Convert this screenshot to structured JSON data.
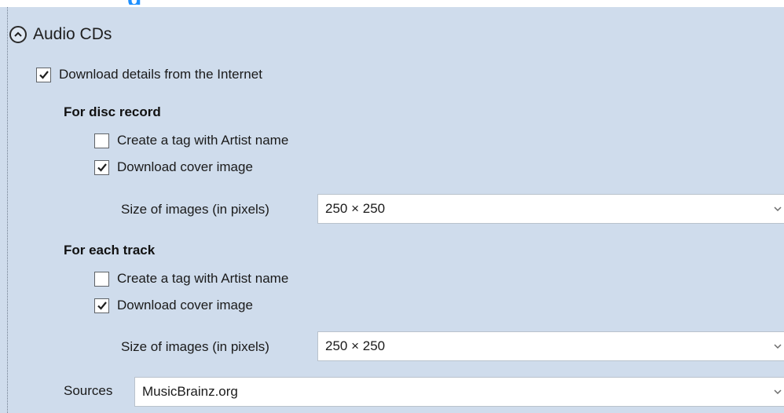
{
  "section": {
    "title": "Audio CDs"
  },
  "download_details": {
    "label": "Download details from the Internet",
    "checked": true
  },
  "disc_record": {
    "heading": "For disc record",
    "artist_tag": {
      "label": "Create a tag with Artist name",
      "checked": false
    },
    "cover_image": {
      "label": "Download cover image",
      "checked": true
    },
    "size_label": "Size of images (in pixels)",
    "size_value": "250 × 250"
  },
  "each_track": {
    "heading": "For each track",
    "artist_tag": {
      "label": "Create a tag with Artist name",
      "checked": false
    },
    "cover_image": {
      "label": "Download cover image",
      "checked": true
    },
    "size_label": "Size of images (in pixels)",
    "size_value": "250 × 250"
  },
  "sources": {
    "label": "Sources",
    "value": "MusicBrainz.org"
  },
  "colors": {
    "panel_background": "#cfdcec",
    "partial_heading": "#1e90ff"
  },
  "icons": {
    "collapse": "chevron-up-in-circle",
    "check": "checkmark",
    "dropdown": "chevron-down"
  }
}
